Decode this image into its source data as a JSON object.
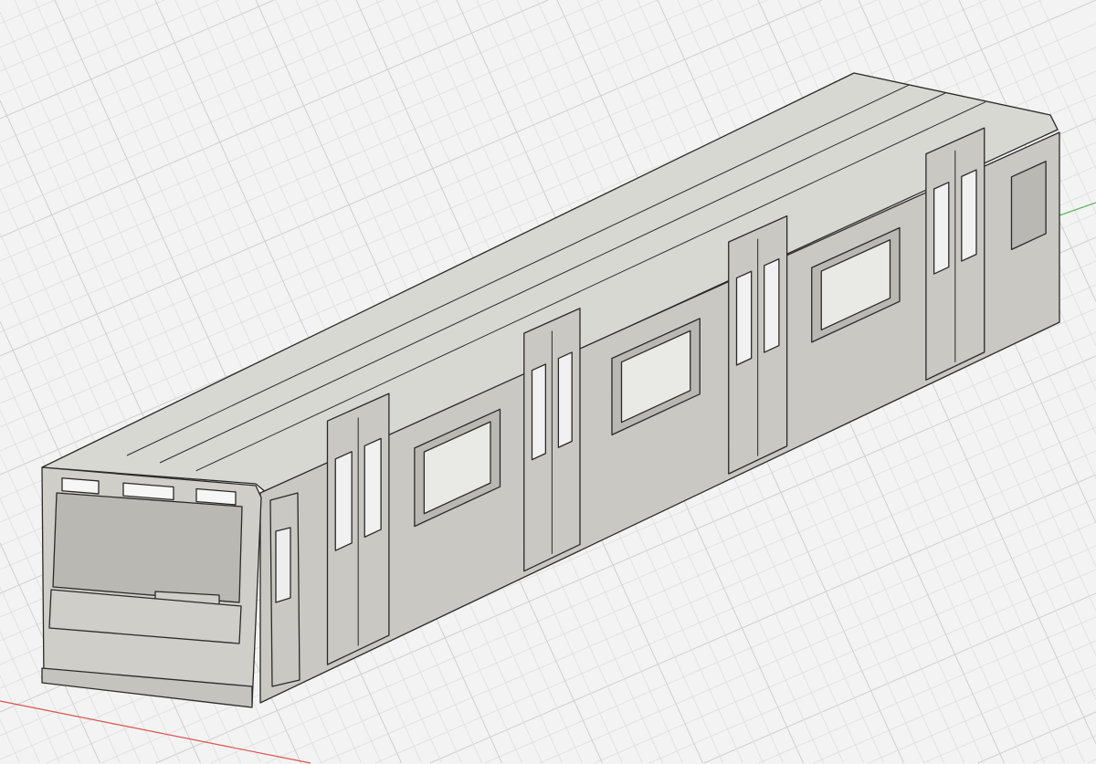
{
  "viewport": {
    "colors": {
      "background": "#f3f3f3",
      "grid_minor": "#e2e2e2",
      "grid_major": "#cfcfcf",
      "x_axis": "#d9534f",
      "y_axis": "#5cb85c",
      "roof": "#d8d8d2",
      "side": "#c9c8c2",
      "front": "#cfcec8",
      "interior": "#b9b8b2",
      "edge": "#2a2a2a"
    }
  }
}
